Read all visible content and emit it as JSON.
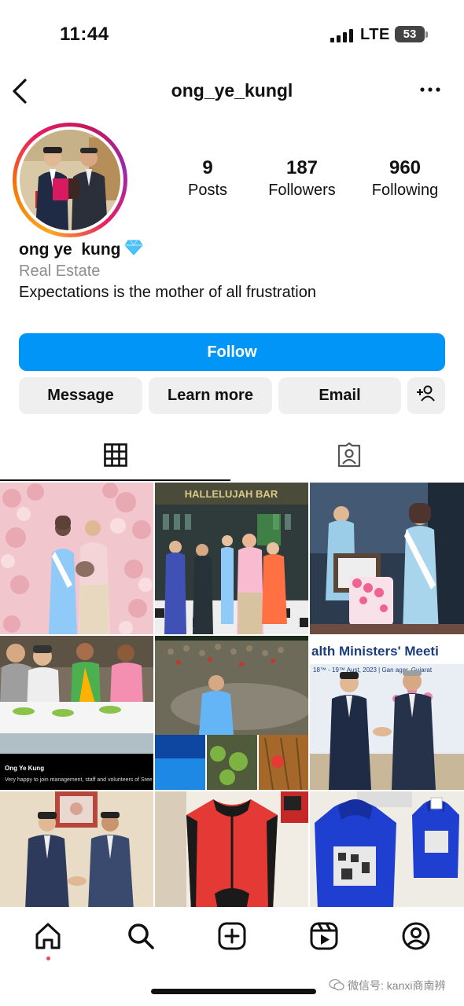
{
  "status": {
    "time": "11:44",
    "network": "LTE",
    "battery": "53"
  },
  "header": {
    "username": "ong_ye_kungl"
  },
  "profile": {
    "display_name": "ong ye  kung",
    "category": "Real Estate",
    "bio": "Expectations is the mother of all frustration",
    "stats": [
      {
        "value": "9",
        "label": "Posts"
      },
      {
        "value": "187",
        "label": "Followers"
      },
      {
        "value": "960",
        "label": "Following"
      }
    ]
  },
  "actions": {
    "follow": "Follow",
    "message": "Message",
    "learn_more": "Learn more",
    "email": "Email"
  },
  "tabs": [
    {
      "icon": "grid-icon",
      "selected": true
    },
    {
      "icon": "tagged-icon",
      "selected": false
    }
  ],
  "posts": [
    {
      "icon": "photo",
      "sign": ""
    },
    {
      "icon": "photo",
      "sign": "HALLELUJAH BAR"
    },
    {
      "icon": "photo",
      "sign": ""
    },
    {
      "icon": "photo",
      "caption_name": "Ong Ye Kung",
      "caption_text": "Very happy to join management, staff and volunteers of Sree"
    },
    {
      "icon": "photo",
      "sign": ""
    },
    {
      "icon": "photo",
      "banner": "alth Ministers' Meeti",
      "subbanner": "18™ - 19™ Aust, 2023 | Gan  agar, Gujarat"
    },
    {
      "icon": "photo"
    },
    {
      "icon": "photo"
    },
    {
      "icon": "photo"
    }
  ],
  "nav": [
    {
      "icon": "home-icon",
      "active": true
    },
    {
      "icon": "search-icon",
      "active": false
    },
    {
      "icon": "create-icon",
      "active": false
    },
    {
      "icon": "reels-icon",
      "active": false
    },
    {
      "icon": "profile-icon",
      "active": false
    }
  ],
  "watermark": "微信号: kanxi商南辨",
  "colors": {
    "follow": "#0095f6",
    "secondary": "#efefef",
    "muted": "#8e8e8e",
    "notification": "#ed4956"
  }
}
